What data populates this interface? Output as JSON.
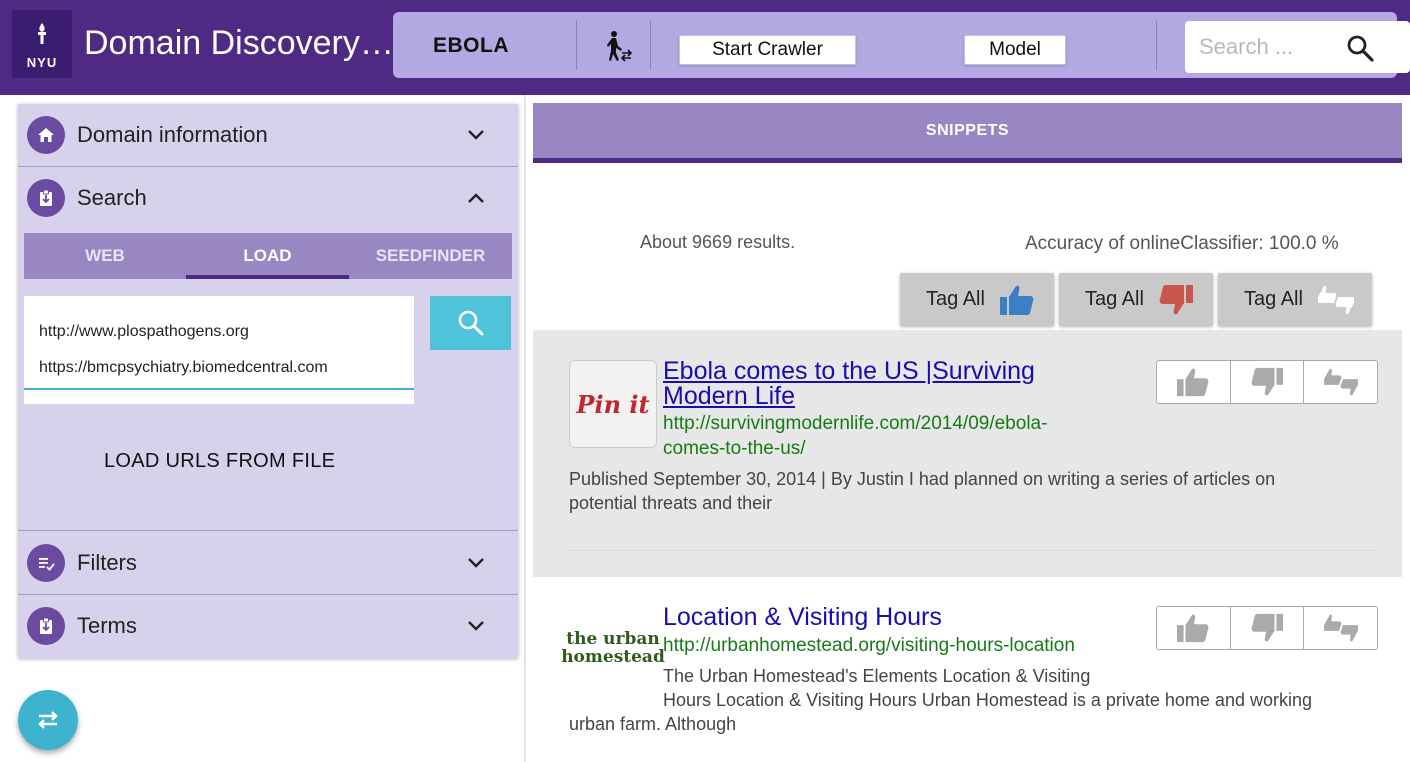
{
  "header": {
    "logo_text": "NYU",
    "app_title": "Domain Discovery Tool",
    "domain": "EBOLA",
    "start_crawler_label": "Start Crawler",
    "model_label": "Model",
    "search_placeholder": "Search ..."
  },
  "sidebar": {
    "domain_info_label": "Domain information",
    "search_label": "Search",
    "tabs": [
      {
        "label": "WEB"
      },
      {
        "label": "LOAD"
      },
      {
        "label": "SEEDFINDER"
      }
    ],
    "active_tab": "LOAD",
    "urls": [
      "http://www.plospathogens.org",
      "https://bmcpsychiatry.biomedcentral.com"
    ],
    "load_file_label": "LOAD URLS FROM FILE",
    "filters_label": "Filters",
    "terms_label": "Terms"
  },
  "main": {
    "tab_label": "SNIPPETS",
    "results_count": "About 9669 results.",
    "accuracy": "Accuracy of onlineClassifier: 100.0 %",
    "tag_all_relevant": "Tag All",
    "tag_all_irrelevant": "Tag All",
    "tag_all_neutral": "Tag All",
    "results": [
      {
        "title_line1": "Ebola comes to the US |Surviving",
        "title_line2": "Modern Life",
        "url_line1": "http://survivingmodernlife.com/2014/09/ebola-",
        "url_line2": "comes-to-the-us/",
        "desc_line1": "Published September 30, 2014 | By Justin I had planned on writing a series of articles on",
        "desc_line2": "potential threats and their",
        "thumb_text": "Pin it"
      },
      {
        "title_line1": "Location & Visiting Hours",
        "url_line1": "http://urbanhomestead.org/visiting-hours-location",
        "desc_line1": "The Urban Homestead's Elements Location & Visiting",
        "desc_line2": "Hours Location & Visiting Hours Urban Homestead is a private home and working",
        "desc_line3": "urban farm. Although",
        "thumb_text": "the urban homestead"
      }
    ]
  },
  "colors": {
    "header_bg": "#4e2a84",
    "toolbar_bg": "#b3a8e2",
    "panel_bg": "#d8d1eb",
    "accent_cyan": "#4fc3d9",
    "thumb_up": "#3d7fc4",
    "thumb_down": "#c9564e"
  },
  "icons": [
    "crawler-icon",
    "search-icon",
    "home-icon",
    "download-icon",
    "filter-list-icon",
    "chevron-down-icon",
    "chevron-up-icon",
    "swap-icon",
    "thumb-up-icon",
    "thumb-down-icon",
    "thumbs-neutral-icon"
  ]
}
